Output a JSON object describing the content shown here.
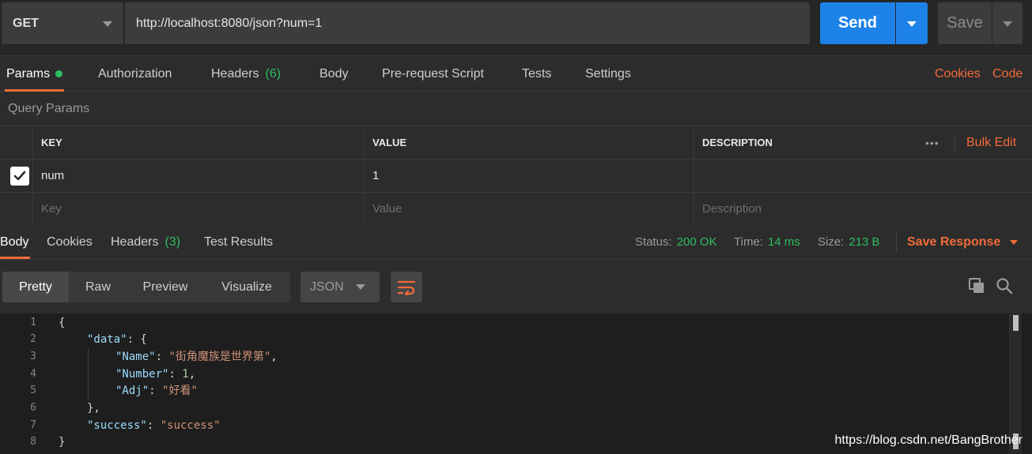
{
  "request": {
    "method": "GET",
    "url": "http://localhost:8080/json?num=1",
    "send_label": "Send",
    "save_label": "Save"
  },
  "req_tabs": {
    "params": "Params",
    "authorization": "Authorization",
    "headers": "Headers",
    "headers_count": "(6)",
    "body": "Body",
    "pre_request": "Pre-request Script",
    "tests": "Tests",
    "settings": "Settings",
    "cookies": "Cookies",
    "code": "Code"
  },
  "query_params": {
    "title": "Query Params",
    "col_key": "KEY",
    "col_value": "VALUE",
    "col_description": "DESCRIPTION",
    "more": "•••",
    "bulk_edit": "Bulk Edit",
    "rows": [
      {
        "key": "num",
        "value": "1",
        "description": "",
        "checked": true
      }
    ],
    "placeholder_key": "Key",
    "placeholder_value": "Value",
    "placeholder_description": "Description"
  },
  "resp_tabs": {
    "body": "Body",
    "cookies": "Cookies",
    "headers": "Headers",
    "headers_count": "(3)",
    "test_results": "Test Results",
    "status_label": "Status:",
    "status_value": "200 OK",
    "time_label": "Time:",
    "time_value": "14 ms",
    "size_label": "Size:",
    "size_value": "213 B",
    "save_response": "Save Response"
  },
  "viewer": {
    "pretty": "Pretty",
    "raw": "Raw",
    "preview": "Preview",
    "visualize": "Visualize",
    "format": "JSON"
  },
  "code": {
    "line_numbers": [
      "1",
      "2",
      "3",
      "4",
      "5",
      "6",
      "7",
      "8"
    ],
    "l1": "{",
    "l2_key": "\"data\"",
    "l2_rest": ": {",
    "l3_key": "\"Name\"",
    "l3_sep": ": ",
    "l3_val": "\"街角魔族是世界第\"",
    "l3_end": ",",
    "l4_key": "\"Number\"",
    "l4_sep": ": ",
    "l4_val": "1",
    "l4_end": ",",
    "l5_key": "\"Adj\"",
    "l5_sep": ": ",
    "l5_val": "\"好看\"",
    "l6": "},",
    "l7_key": "\"success\"",
    "l7_sep": ": ",
    "l7_val": "\"success\"",
    "l8": "}"
  },
  "watermark": "https://blog.csdn.net/BangBrother",
  "colors": {
    "accent": "#f26b3a",
    "send": "#1d82e8",
    "success": "#2dbd60"
  }
}
